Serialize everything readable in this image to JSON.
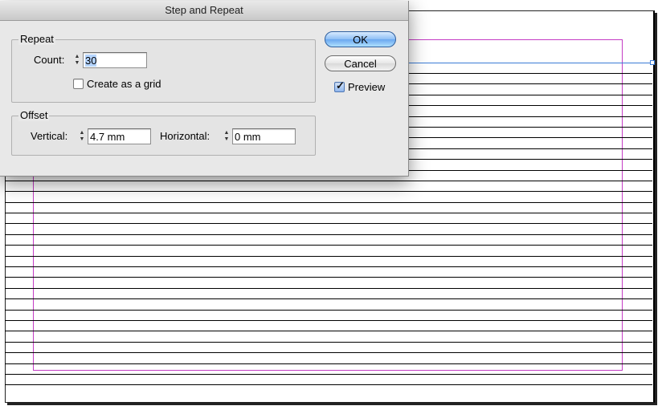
{
  "dialog": {
    "title": "Step and Repeat",
    "repeat": {
      "legend": "Repeat",
      "count_label": "Count:",
      "count_value": "30",
      "grid_label": "Create as a grid",
      "grid_checked": false
    },
    "offset": {
      "legend": "Offset",
      "vertical_label": "Vertical:",
      "vertical_value": "4.7 mm",
      "horizontal_label": "Horizontal:",
      "horizontal_value": "0 mm"
    },
    "buttons": {
      "ok": "OK",
      "cancel": "Cancel"
    },
    "preview": {
      "label": "Preview",
      "checked": true
    }
  },
  "colors": {
    "margin_guide": "#c43cc4",
    "selection": "#3a7bd5",
    "default_button": "#6aa7ef"
  },
  "icons": [
    "stepper-icon",
    "checkmark-icon",
    "selection-handle-icon"
  ]
}
